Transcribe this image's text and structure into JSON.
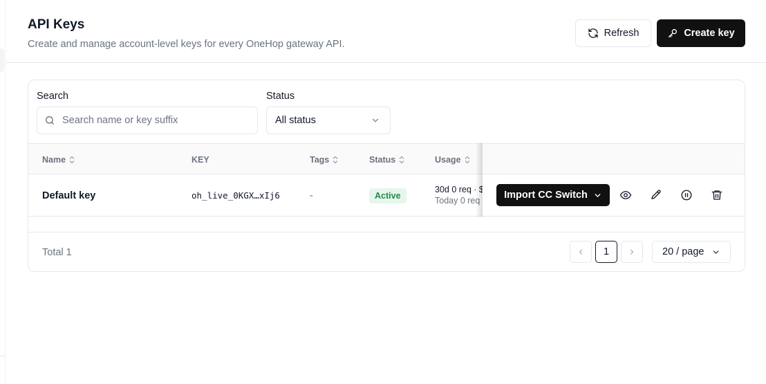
{
  "header": {
    "title": "API Keys",
    "subtitle": "Create and manage account-level keys for every OneHop gateway API.",
    "refresh_label": "Refresh",
    "create_label": "Create key"
  },
  "filters": {
    "search_label": "Search",
    "search_placeholder": "Search name or key suffix",
    "search_value": "",
    "status_label": "Status",
    "status_value": "All status"
  },
  "table": {
    "columns": [
      "Name",
      "KEY",
      "Tags",
      "Status",
      "Usage"
    ],
    "rows": [
      {
        "name": "Default key",
        "key": "oh_live_0KGX…xIj6",
        "tags": "-",
        "status": "Active",
        "usage_30d": "30d 0 req · $",
        "usage_today": "Today 0 req",
        "action_label": "Import CC Switch"
      }
    ]
  },
  "footer": {
    "total": "Total 1",
    "current_page": "1",
    "page_size": "20 / page"
  },
  "colors": {
    "primary": "#111111",
    "active_bg": "#e7f6ec",
    "active_text": "#1f8a46",
    "border": "#e5e7eb",
    "muted_text": "#6b7280"
  },
  "icons": [
    "refresh-icon",
    "key-icon",
    "search-icon",
    "chevron-down-icon",
    "sort-icon",
    "eye-icon",
    "pencil-icon",
    "pause-icon",
    "trash-icon",
    "chevron-left-icon",
    "chevron-right-icon"
  ]
}
